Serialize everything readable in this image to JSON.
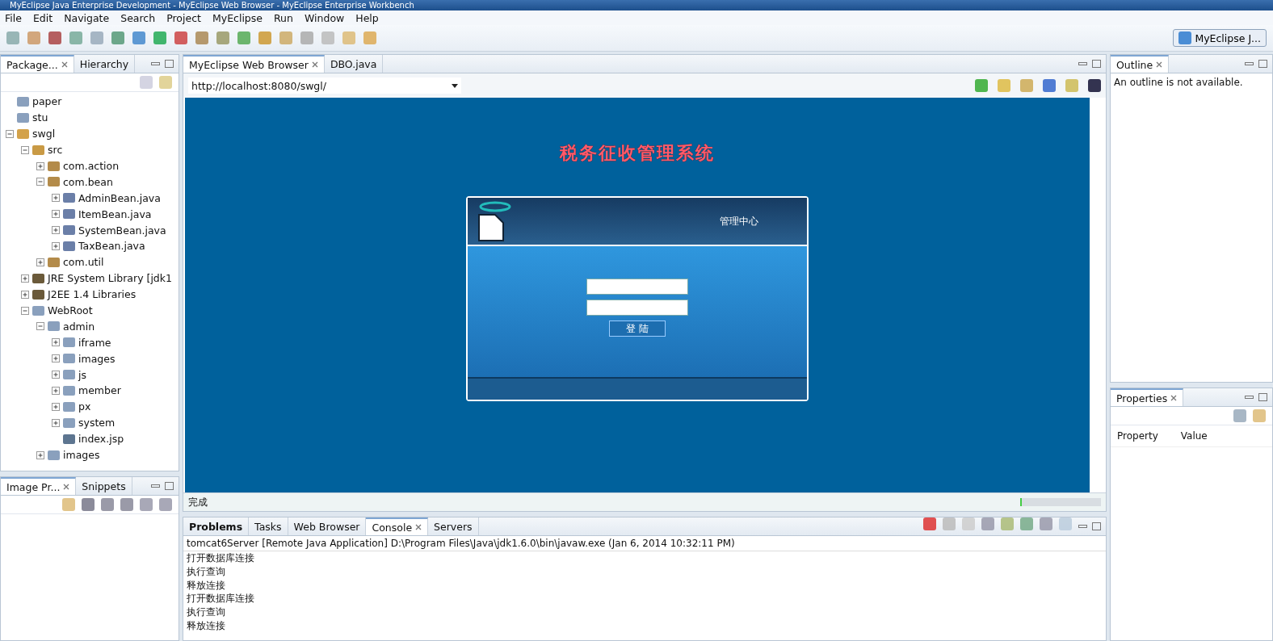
{
  "window": {
    "title": "MyEclipse Java Enterprise Development - MyEclipse Web Browser - MyEclipse Enterprise Workbench"
  },
  "menu": [
    "File",
    "Edit",
    "Navigate",
    "Search",
    "Project",
    "MyEclipse",
    "Run",
    "Window",
    "Help"
  ],
  "perspective": {
    "label": "MyEclipse J..."
  },
  "explorer": {
    "tabs": [
      {
        "label": "Package...",
        "selected": true
      },
      {
        "label": "Hierarchy",
        "selected": false
      }
    ],
    "tree": [
      {
        "label": "paper",
        "kind": "folder"
      },
      {
        "label": "stu",
        "kind": "folder"
      },
      {
        "label": "swgl",
        "kind": "project",
        "expanded": true,
        "children": [
          {
            "label": "src",
            "kind": "source",
            "expanded": true,
            "children": [
              {
                "label": "com.action",
                "kind": "package",
                "expanded": false
              },
              {
                "label": "com.bean",
                "kind": "package",
                "expanded": true,
                "children": [
                  {
                    "label": "AdminBean.java",
                    "kind": "java",
                    "expanded": false
                  },
                  {
                    "label": "ItemBean.java",
                    "kind": "java",
                    "expanded": false
                  },
                  {
                    "label": "SystemBean.java",
                    "kind": "java",
                    "expanded": false
                  },
                  {
                    "label": "TaxBean.java",
                    "kind": "java",
                    "expanded": false
                  }
                ]
              },
              {
                "label": "com.util",
                "kind": "package",
                "expanded": false
              }
            ]
          },
          {
            "label": "JRE System Library [jdk1",
            "kind": "library",
            "expanded": false
          },
          {
            "label": "J2EE 1.4 Libraries",
            "kind": "library",
            "expanded": false
          },
          {
            "label": "WebRoot",
            "kind": "folder",
            "expanded": true,
            "children": [
              {
                "label": "admin",
                "kind": "folder",
                "expanded": true,
                "children": [
                  {
                    "label": "iframe",
                    "kind": "folder",
                    "expanded": false
                  },
                  {
                    "label": "images",
                    "kind": "folder",
                    "expanded": false
                  },
                  {
                    "label": "js",
                    "kind": "folder",
                    "expanded": false
                  },
                  {
                    "label": "member",
                    "kind": "folder",
                    "expanded": false
                  },
                  {
                    "label": "px",
                    "kind": "folder",
                    "expanded": false
                  },
                  {
                    "label": "system",
                    "kind": "folder",
                    "expanded": false
                  },
                  {
                    "label": "index.jsp",
                    "kind": "file"
                  }
                ]
              },
              {
                "label": "images",
                "kind": "folder",
                "expanded": false
              }
            ]
          }
        ]
      }
    ]
  },
  "preview": {
    "tabs": [
      {
        "label": "Image Pr...",
        "selected": true
      },
      {
        "label": "Snippets",
        "selected": false
      }
    ]
  },
  "editor": {
    "tabs": [
      {
        "label": "MyEclipse Web Browser",
        "selected": true
      },
      {
        "label": "DBO.java",
        "selected": false
      }
    ],
    "url": "http://localhost:8080/swgl/",
    "page": {
      "heading": "税务征收管理系统",
      "panel_title": "管理中心",
      "login_button": "登 陆"
    },
    "status": "完成",
    "progress": {
      "level": 0.02
    }
  },
  "console": {
    "tabs": [
      {
        "label": "Problems",
        "selected": false,
        "bold": true
      },
      {
        "label": "Tasks",
        "selected": false,
        "bold": false
      },
      {
        "label": "Web Browser",
        "selected": false,
        "bold": false
      },
      {
        "label": "Console",
        "selected": true,
        "bold": false
      },
      {
        "label": "Servers",
        "selected": false,
        "bold": false
      }
    ],
    "header": "tomcat6Server [Remote Java Application] D:\\Program Files\\Java\\jdk1.6.0\\bin\\javaw.exe (Jan 6, 2014 10:32:11 PM)",
    "lines": [
      "打开数据库连接",
      "执行查询",
      "释放连接",
      "打开数据库连接",
      "执行查询",
      "释放连接"
    ]
  },
  "outline": {
    "tab": "Outline",
    "message": "An outline is not available."
  },
  "properties": {
    "tab": "Properties",
    "columns": [
      "Property",
      "Value"
    ]
  }
}
